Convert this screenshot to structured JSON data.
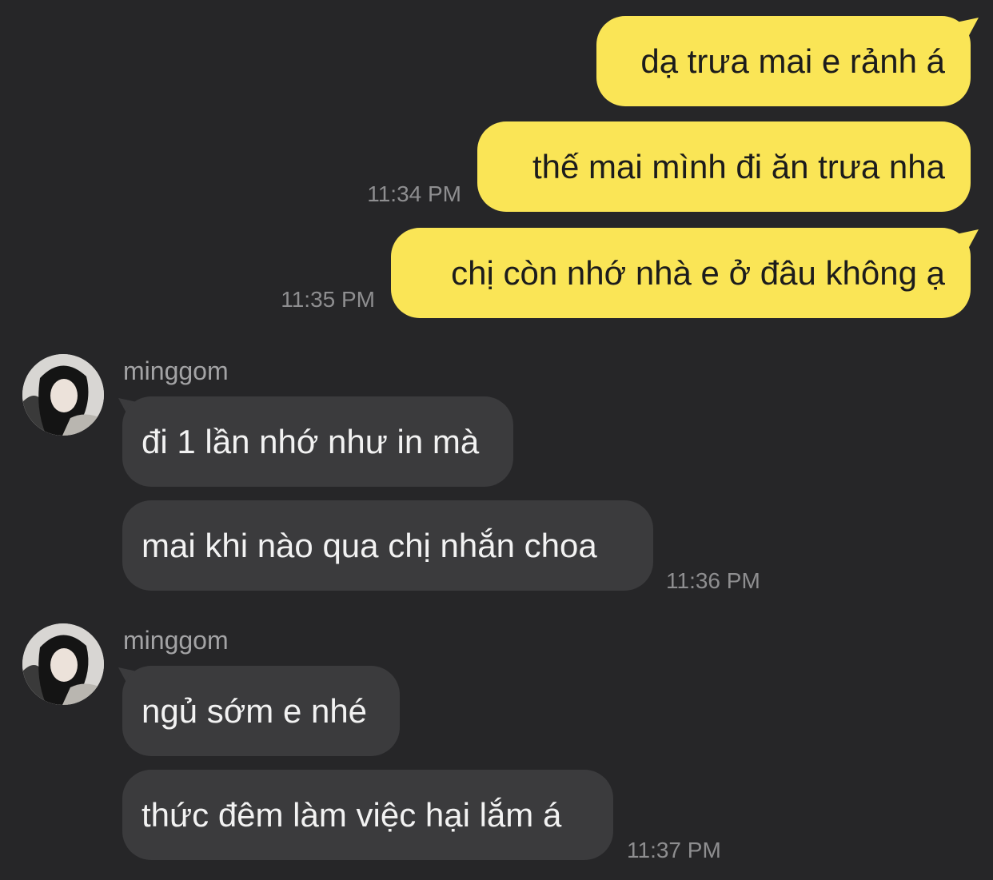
{
  "colors": {
    "background": "#262628",
    "outgoing_bubble": "#fae556",
    "incoming_bubble": "#3b3b3d",
    "timestamp": "#8e8e90"
  },
  "outgoing": [
    {
      "text": "dạ trưa mai e rảnh á",
      "time": ""
    },
    {
      "text": "thế mai mình đi ăn trưa nha",
      "time": "11:34 PM"
    },
    {
      "text": "chị còn nhớ nhà e ở đâu không ạ",
      "time": "11:35 PM"
    }
  ],
  "groups": [
    {
      "sender": "minggom",
      "avatar_icon": "profile-photo",
      "messages": [
        {
          "text": "đi 1 lần nhớ như in mà",
          "time": ""
        },
        {
          "text": "mai khi nào qua chị nhắn choa",
          "time": "11:36 PM"
        }
      ]
    },
    {
      "sender": "minggom",
      "avatar_icon": "profile-photo",
      "messages": [
        {
          "text": "ngủ sớm e nhé",
          "time": ""
        },
        {
          "text": "thức đêm làm việc hại lắm á",
          "time": "11:37 PM"
        }
      ]
    }
  ]
}
